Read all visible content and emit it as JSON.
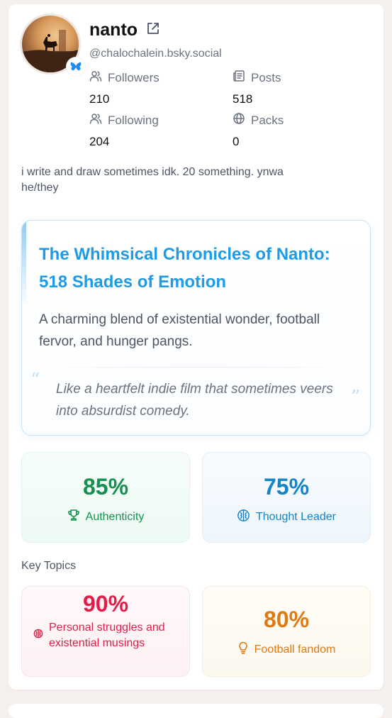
{
  "profile": {
    "name": "nanto",
    "handle": "@chalochalein.bsky.social",
    "bio_line1": "i write and draw sometimes idk. 20 something. ynwa",
    "bio_line2": "he/they"
  },
  "stats": {
    "followers_label": "Followers",
    "followers_value": "210",
    "posts_label": "Posts",
    "posts_value": "518",
    "following_label": "Following",
    "following_value": "204",
    "packs_label": "Packs",
    "packs_value": "0"
  },
  "summary": {
    "title": "The Whimsical Chronicles of Nanto: 518 Shades of Emotion",
    "description": "A charming blend of existential wonder, football fervor, and hunger pangs.",
    "quote": "Like a heartfelt indie film that sometimes veers into absurdist comedy.",
    "quote_open": "“",
    "quote_close": "”"
  },
  "metrics": {
    "authenticity_pct": "85%",
    "authenticity_label": "Authenticity",
    "thought_pct": "75%",
    "thought_label": "Thought Leader"
  },
  "topics": {
    "heading": "Key Topics",
    "struggles_pct": "90%",
    "struggles_label": "Personal struggles and existential musings",
    "football_pct": "80%",
    "football_label": "Football fandom"
  },
  "colors": {
    "brand_blue": "#1d9be6",
    "green": "#15904f",
    "blue": "#1683c6",
    "red": "#e11d48",
    "orange": "#dd7a13"
  },
  "icons": {
    "external_link": "external-link-icon",
    "followers": "users-icon",
    "posts": "document-icon",
    "following": "users-icon",
    "packs": "globe-icon",
    "authenticity": "trophy-icon",
    "thought": "brain-icon",
    "struggles": "brain-icon",
    "football": "lightbulb-icon",
    "verified": "butterfly-icon"
  }
}
